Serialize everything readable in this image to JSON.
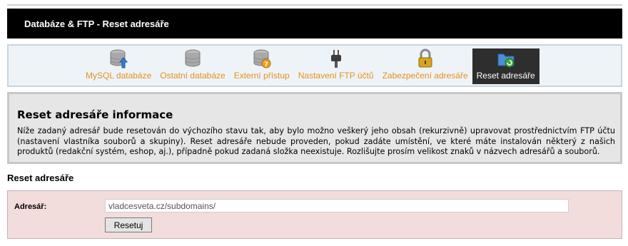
{
  "header": {
    "title": "Databáze & FTP - Reset adresáře"
  },
  "nav": {
    "items": [
      {
        "label": "MySQL databáze",
        "icon": "database-upload-icon"
      },
      {
        "label": "Ostatní databáze",
        "icon": "database-icon"
      },
      {
        "label": "Externí přístup",
        "icon": "database-help-icon"
      },
      {
        "label": "Nastavení FTP účtů",
        "icon": "plug-icon"
      },
      {
        "label": "Zabezpečení adresáře",
        "icon": "lock-icon"
      },
      {
        "label": "Reset adresáře",
        "icon": "folder-refresh-icon",
        "active": true
      }
    ],
    "accent_color": "#e8901c"
  },
  "info": {
    "title": "Reset adresáře informace",
    "text": "Níže zadaný adresář bude resetován do výchozího stavu tak, aby bylo možno veškerý jeho obsah (rekurzivně) upravovat prostřednictvím FTP účtu (nastavení vlastníka souborů a skupiny). Reset adresáře nebude proveden, pokud zadáte umístění, ve které máte instalován některý z našich produktů (redakční systém, eshop, aj.), případně pokud zadaná složka neexistuje. Rozlišujte prosím velikost znaků v názvech adresářů a souborů."
  },
  "form": {
    "section_title": "Reset adresáře",
    "directory_label": "Adresář:",
    "directory_value": "vladcesveta.cz/subdomains/",
    "submit_label": "Resetuj"
  }
}
